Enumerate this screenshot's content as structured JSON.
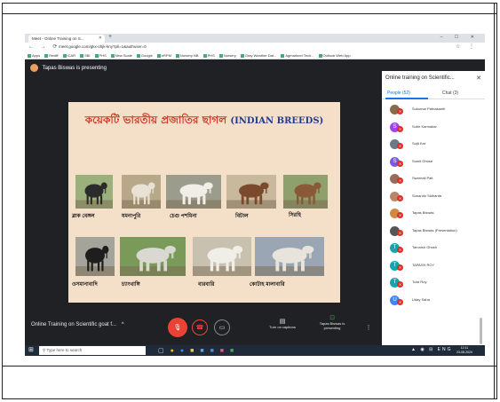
{
  "browser": {
    "tab_title": "Meet - Online Training on S...",
    "new_tab": "+",
    "window_controls": "–  ☐  ✕",
    "nav": "← → ⟳",
    "url": "meet.google.com/gkx-ohjk-kny?pli=1&authuser=0",
    "url_right": "☆ ⋮",
    "bookmarks": [
      "Apps",
      "Rediff",
      "ICAR",
      "SBI",
      "PHS",
      "New Scale",
      "Google",
      "eRPM",
      "Nursery NB",
      "PHS",
      "Nursery",
      "Gray Weather Dat...",
      "Agmarknet Tech...",
      "Outlook Web App"
    ]
  },
  "meet": {
    "presenter_text": "Tapas Biswas is presenting",
    "meeting_title": "Online Training on Scientific goat f...",
    "chevron": "^",
    "mic_icon": "🎙",
    "end_call_icon": "☎",
    "camera_icon": "▭",
    "captions_label": "Turn on captions",
    "captions_icon": "▤",
    "presenting_label": "Tapas Biswas is presenting",
    "presenting_icon": "⊡",
    "more_icon": "⋮"
  },
  "slide": {
    "title_bn": "কয়েকটি ভারতীয় প্রজাতির ছাগল",
    "title_en": "(INDIAN BREEDS)",
    "goats": [
      {
        "label": "ব্লাক বেঙ্গল"
      },
      {
        "label": "যমনাপুরি"
      },
      {
        "label": "চেগু পশমিনা"
      },
      {
        "label": "বিটাল"
      },
      {
        "label": "সিরহি"
      },
      {
        "label": "ওসমানাবাদি"
      },
      {
        "label": "চ্যাংথাঙ্গি"
      },
      {
        "label": "বারবারি"
      },
      {
        "label": "কোটাহ মালাবারি"
      },
      {
        "label": ""
      },
      {
        "label": ""
      },
      {
        "label": ""
      },
      {
        "label": ""
      }
    ]
  },
  "panel": {
    "header": "Online training on Scientific...",
    "close": "✕",
    "tab_people": "People (52)",
    "tab_chat": "Chat (3)",
    "people": [
      {
        "name": "Sukumar Patnakanth",
        "initial": ""
      },
      {
        "name": "Subir Karmakar",
        "initial": "S"
      },
      {
        "name": "Sujit Kar",
        "initial": ""
      },
      {
        "name": "Sumit Ghose",
        "initial": "S"
      },
      {
        "name": "Swarnali Pati",
        "initial": ""
      },
      {
        "name": "Sunando Sidhanta",
        "initial": ""
      },
      {
        "name": "Tapas Biswas",
        "initial": ""
      },
      {
        "name": "Tapas Biswas (Presentation)",
        "initial": ""
      },
      {
        "name": "Tarunish Ghosh",
        "initial": "T"
      },
      {
        "name": "TAPASH ROY",
        "initial": "T"
      },
      {
        "name": "Tulsi Roy",
        "initial": "T"
      },
      {
        "name": "Uday Saha",
        "initial": "U"
      }
    ]
  },
  "taskbar": {
    "search_placeholder": "Type here to search",
    "start_icon": "⊞",
    "time": "12:11",
    "date": "23-08-2020",
    "lang": "ENG"
  },
  "colors": {
    "title_red": "#d23a2a",
    "title_blue": "#223c8c",
    "end_call": "#ea4335",
    "accent": "#1a73e8"
  }
}
